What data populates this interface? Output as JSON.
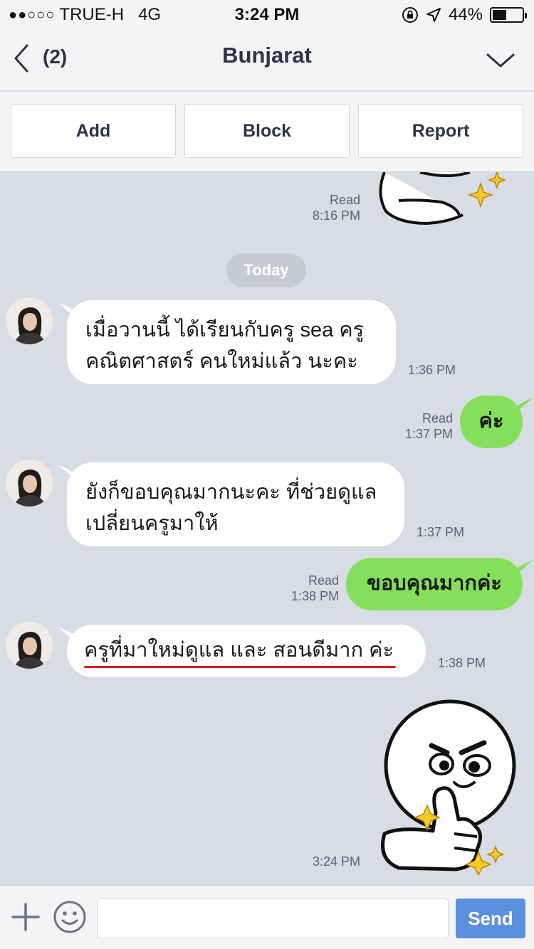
{
  "status_bar": {
    "signal": "●●○○○",
    "carrier": "TRUE-H",
    "network": "4G",
    "time": "3:24 PM",
    "battery_percent": "44%",
    "battery_level": 0.44
  },
  "nav": {
    "back_count": "(2)",
    "title": "Bunjarat"
  },
  "actions": {
    "add": "Add",
    "block": "Block",
    "report": "Report"
  },
  "chat": {
    "top_sticker": {
      "read": "Read",
      "time": "8:16 PM"
    },
    "date_divider": "Today",
    "messages": [
      {
        "sender": "them",
        "lines": [
          "เมื่อวานนี้ ได้เรียนกับครู sea ครู",
          "คณิตศาสตร์ คนใหม่แล้ว นะคะ"
        ],
        "time": "1:36 PM"
      },
      {
        "sender": "me",
        "text": "ค่ะ",
        "read": "Read",
        "time": "1:37 PM"
      },
      {
        "sender": "them",
        "lines": [
          "ยังก็ขอบคุณมากนะคะ ที่ช่วยดูแล",
          "เปลี่ยนครูมาให้"
        ],
        "time": "1:37 PM"
      },
      {
        "sender": "me",
        "text": "ขอบคุณมากค่ะ",
        "read": "Read",
        "time": "1:38 PM"
      },
      {
        "sender": "them",
        "text": "ครูที่มาใหม่ดูแล และ สอนดีมาก ค่ะ",
        "time": "1:38 PM"
      }
    ],
    "bottom_sticker": {
      "time": "3:24 PM"
    }
  },
  "input_bar": {
    "placeholder": "",
    "send": "Send"
  },
  "colors": {
    "chat_bg": "#d7dce5",
    "my_bubble": "#84e05a",
    "send_button": "#5b8fe0",
    "underline": "#d41e1e"
  }
}
